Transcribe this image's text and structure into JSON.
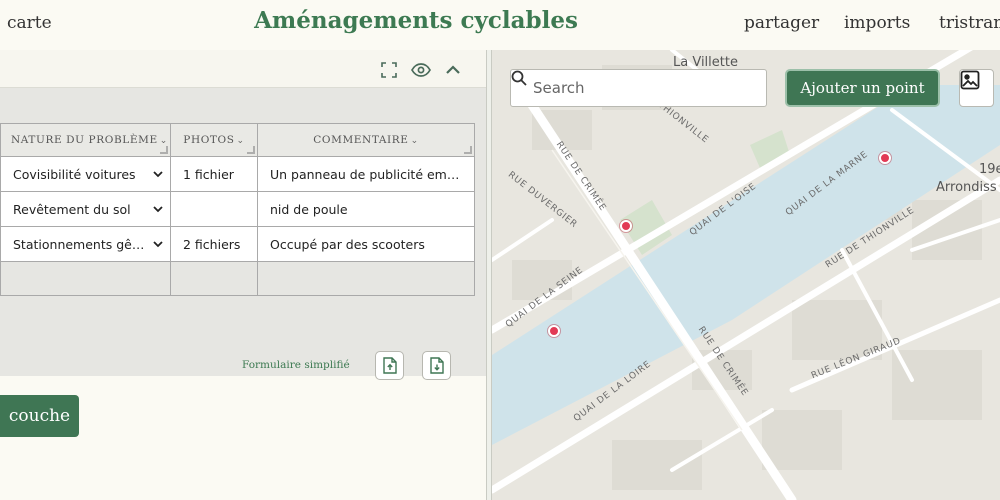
{
  "header": {
    "nav_left": "carte",
    "title": "Aménagements cyclables",
    "nav_share": "partager",
    "nav_imports": "imports",
    "nav_user": "tristram"
  },
  "panel": {
    "toolbar_icons": [
      "expand-icon",
      "eye-icon",
      "chevron-up-icon"
    ],
    "columns": [
      {
        "label": "NATURE DU PROBLÈME",
        "sortable": true
      },
      {
        "label": "PHOTOS",
        "sortable": true
      },
      {
        "label": "COMMENTAIRE",
        "sortable": true
      }
    ],
    "rows": [
      {
        "nature": "Covisibilité voitures",
        "photos": "1 fichier",
        "comment": "Un panneau de publicité empêchant la visibilité"
      },
      {
        "nature": "Revêtement du sol",
        "photos": "",
        "comment": "nid de poule"
      },
      {
        "nature": "Stationnements gênants",
        "photos": "2 fichiers",
        "comment": "Occupé par des scooters"
      }
    ],
    "form_link": "Formulaire simplifié",
    "layer_button": "couche"
  },
  "map": {
    "search_placeholder": "Search",
    "add_point_label": "Ajouter un point",
    "places": {
      "villette": "La Villette",
      "district_num": "19e",
      "district_word": "Arrondiss"
    },
    "streets": {
      "crimee_1": "RUE DE CRIMÉE",
      "crimee_2": "RUE DE CRIMÉE",
      "duvergier": "RUE DUVERGIER",
      "thionville_top": "THIONVILLE",
      "quai_oise": "QUAI DE L'OISE",
      "quai_marne": "QUAI DE LA MARNE",
      "rue_thionville": "RUE DE THIONVILLE",
      "quai_seine": "QUAI DE LA SEINE",
      "quai_loire": "QUAI DE LA LOIRE",
      "leon_giraud": "RUE LÉON GIRAUD"
    },
    "marker_color": "#e23a55",
    "water_color": "#cfe3ea",
    "accent_color": "#3f7654"
  }
}
